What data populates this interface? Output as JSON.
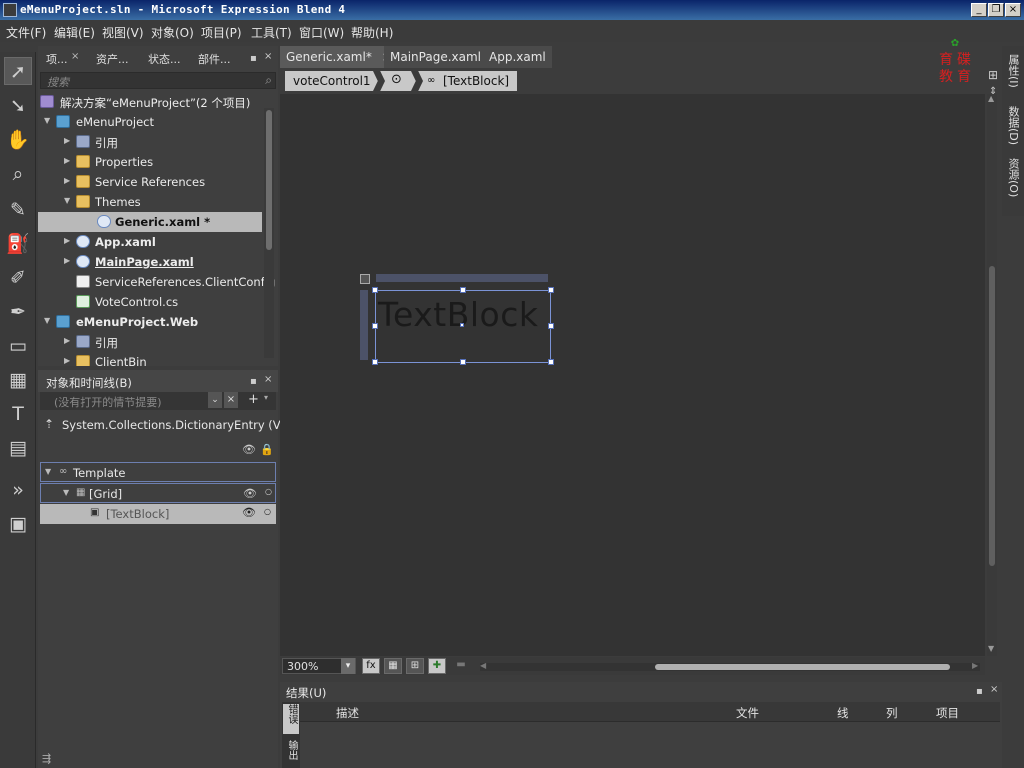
{
  "window": {
    "title": "eMenuProject.sln - Microsoft Expression Blend 4"
  },
  "menu": [
    "文件(F)",
    "编辑(E)",
    "视图(V)",
    "对象(O)",
    "项目(P)",
    "工具(T)",
    "窗口(W)",
    "帮助(H)"
  ],
  "project_panel": {
    "tabs": [
      "项...",
      "资产...",
      "状态...",
      "部件..."
    ],
    "search_placeholder": "搜索",
    "tree": [
      {
        "label": "解决方案“eMenuProject”(2 个项目)",
        "icon": "solution-icon"
      },
      {
        "label": "eMenuProject",
        "icon": "project-icon"
      },
      {
        "label": "引用",
        "icon": "references-icon"
      },
      {
        "label": "Properties",
        "icon": "folder-icon"
      },
      {
        "label": "Service References",
        "icon": "folder-icon"
      },
      {
        "label": "Themes",
        "icon": "folder-open-icon"
      },
      {
        "label": "Generic.xaml *",
        "icon": "xaml-icon"
      },
      {
        "label": "App.xaml",
        "icon": "xaml-icon"
      },
      {
        "label": "MainPage.xaml",
        "icon": "xaml-icon"
      },
      {
        "label": "ServiceReferences.ClientConfig",
        "icon": "file-icon"
      },
      {
        "label": "VoteControl.cs",
        "icon": "cs-icon"
      },
      {
        "label": "eMenuProject.Web",
        "icon": "project-icon"
      },
      {
        "label": "引用",
        "icon": "references-icon"
      },
      {
        "label": "ClientBin",
        "icon": "folder-icon"
      }
    ]
  },
  "objects_panel": {
    "title": "对象和时间线(B)",
    "storyboard_placeholder": "(没有打开的情节提要)",
    "scope": "System.Collections.DictionaryEntry (Vo...",
    "rows": [
      "Template",
      "[Grid]",
      "[TextBlock]"
    ]
  },
  "doc_tabs": [
    "Generic.xaml*",
    "MainPage.xaml",
    "App.xaml"
  ],
  "breadcrumb": [
    "voteControl1",
    "[TextBlock]"
  ],
  "artboard": {
    "textblock_text": "TextBlock"
  },
  "zoom": "300%",
  "side_tabs": [
    "属性(I)",
    "数据(D)",
    "资源(O)"
  ],
  "logo_text": [
    "育",
    "碟",
    "教",
    "育"
  ],
  "results_panel": {
    "title": "结果(U)",
    "columns": [
      "描述",
      "文件",
      "线",
      "列",
      "项目"
    ],
    "side_buttons": [
      "错误",
      "输出"
    ]
  }
}
